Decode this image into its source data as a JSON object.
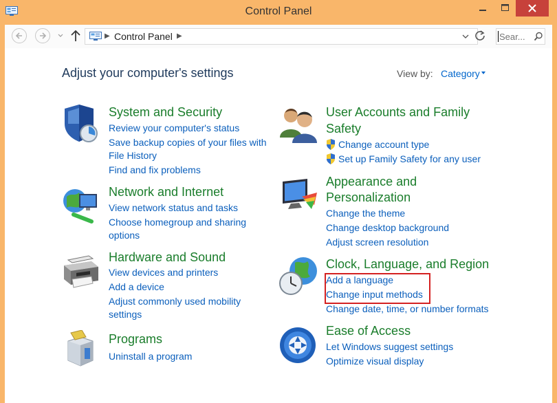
{
  "window": {
    "title": "Control Panel",
    "accent": "#f9b66a",
    "close_color": "#c7413b"
  },
  "toolbar": {
    "address": "Control Panel",
    "search_placeholder": "Sear..."
  },
  "main": {
    "heading": "Adjust your computer's settings",
    "view_by_label": "View by:",
    "view_by_value": "Category"
  },
  "categories": {
    "system": {
      "title": "System and Security",
      "links": [
        "Review your computer's status",
        "Save backup copies of your files with",
        "File History",
        "Find and fix problems"
      ]
    },
    "network": {
      "title": "Network and Internet",
      "links": [
        "View network status and tasks",
        "Choose homegroup and sharing",
        "options"
      ]
    },
    "hardware": {
      "title": "Hardware and Sound",
      "links": [
        "View devices and printers",
        "Add a device",
        "Adjust commonly used mobility",
        "settings"
      ]
    },
    "programs": {
      "title": "Programs",
      "links": [
        "Uninstall a program"
      ]
    },
    "users": {
      "title_line1": "User Accounts and Family",
      "title_line2": "Safety",
      "links": [
        "Change account type",
        "Set up Family Safety for any user"
      ]
    },
    "appearance": {
      "title_line1": "Appearance and",
      "title_line2": "Personalization",
      "links": [
        "Change the theme",
        "Change desktop background",
        "Adjust screen resolution"
      ]
    },
    "clock": {
      "title": "Clock, Language, and Region",
      "links": [
        "Add a language",
        "Change input methods",
        "Change date, time, or number formats"
      ]
    },
    "ease": {
      "title": "Ease of Access",
      "links": [
        "Let Windows suggest settings",
        "Optimize visual display"
      ]
    }
  },
  "colors": {
    "category_title": "#1a7d2b",
    "link": "#0b5fbc",
    "highlight": "#d42020"
  }
}
